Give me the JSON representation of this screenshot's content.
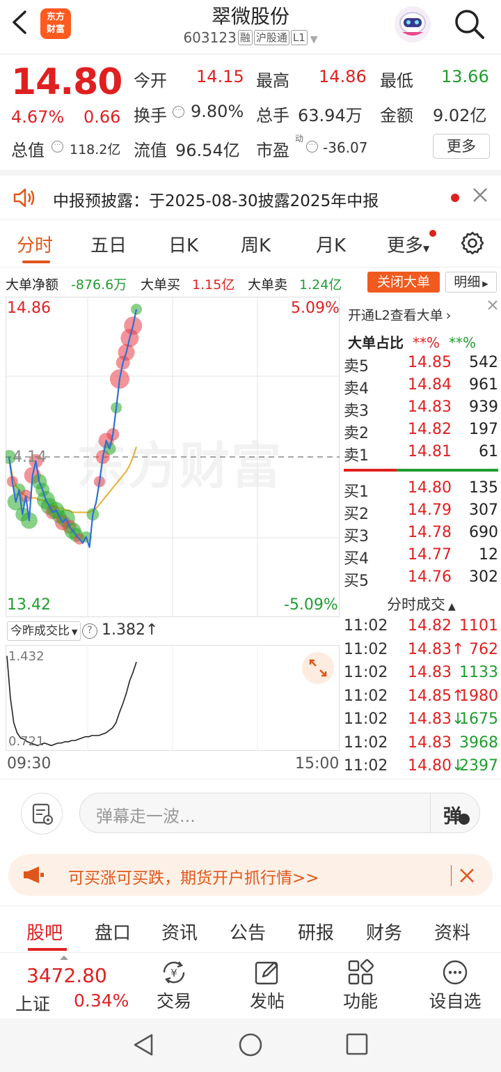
{
  "header": {
    "stock_name": "翠微股份",
    "stock_code": "603123",
    "tags": [
      "融",
      "沪股通",
      "L1"
    ],
    "logo_line1": "东方",
    "logo_line2": "财富"
  },
  "quote": {
    "price": "14.80",
    "change_pct": "4.67%",
    "change": "0.66",
    "open_label": "今开",
    "open": "14.15",
    "high_label": "最高",
    "high": "14.86",
    "low_label": "最低",
    "low": "13.66",
    "turnover_label": "换手",
    "turnover": "9.80%",
    "volume_label": "总手",
    "volume": "63.94万",
    "amount_label": "金额",
    "amount": "9.02亿",
    "mktcap_label": "总值",
    "mktcap": "118.2亿",
    "float_label": "流值",
    "float_cap": "96.54亿",
    "pe_label": "市盈",
    "pe_sup": "动",
    "pe": "-36.07",
    "more": "更多"
  },
  "notice": {
    "text": "中报预披露：于2025-08-30披露2025年中报"
  },
  "tabs": [
    "分时",
    "五日",
    "日K",
    "周K",
    "月K",
    "更多"
  ],
  "big_orders": {
    "net_label": "大单净额",
    "net": "-876.6万",
    "buy_label": "大单买",
    "buy": "1.15亿",
    "sell_label": "大单卖",
    "sell": "1.24亿",
    "close_btn": "关闭大单",
    "detail_btn": "明细"
  },
  "chart_data": {
    "type": "line",
    "title": "",
    "y_top": "14.86",
    "y_mid": "4.14",
    "y_bottom": "13.42",
    "pct_top": "5.09%",
    "pct_bottom": "-5.09%",
    "ylim": [
      13.42,
      14.86
    ],
    "prev_close": 14.14,
    "price_series": [
      14.14,
      14.02,
      13.92,
      13.98,
      13.86,
      13.95,
      13.83,
      14.05,
      14.12,
      14.02,
      13.98,
      13.93,
      13.9,
      13.87,
      13.88,
      13.85,
      13.82,
      13.84,
      13.8,
      13.78,
      13.76,
      13.74,
      13.72,
      13.75,
      13.7,
      13.86,
      13.92,
      14.02,
      14.14,
      14.22,
      14.18,
      14.25,
      14.38,
      14.52,
      14.6,
      14.65,
      14.72,
      14.78,
      14.86
    ],
    "avg_series": [
      14.14,
      14.05,
      14.0,
      13.98,
      13.96,
      13.95,
      13.94,
      13.94,
      13.94,
      13.93,
      13.93,
      13.92,
      13.91,
      13.9,
      13.9,
      13.89,
      13.89,
      13.88,
      13.88,
      13.87,
      13.87,
      13.87,
      13.87,
      13.87,
      13.87,
      13.88,
      13.89,
      13.91,
      13.93,
      13.95,
      13.97,
      13.99,
      14.01,
      14.03,
      14.05,
      14.07,
      14.1,
      14.14,
      14.19
    ],
    "bubbles": [
      {
        "i": 0,
        "c": "g",
        "s": 10
      },
      {
        "i": 1,
        "c": "r",
        "s": 8
      },
      {
        "i": 2,
        "c": "g",
        "s": 12
      },
      {
        "i": 3,
        "c": "g",
        "s": 9
      },
      {
        "i": 4,
        "c": "g",
        "s": 10
      },
      {
        "i": 5,
        "c": "r",
        "s": 9
      },
      {
        "i": 6,
        "c": "g",
        "s": 12
      },
      {
        "i": 7,
        "c": "r",
        "s": 12
      },
      {
        "i": 8,
        "c": "r",
        "s": 10
      },
      {
        "i": 9,
        "c": "g",
        "s": 11
      },
      {
        "i": 10,
        "c": "g",
        "s": 10
      },
      {
        "i": 11,
        "c": "g",
        "s": 13
      },
      {
        "i": 12,
        "c": "g",
        "s": 12
      },
      {
        "i": 13,
        "c": "r",
        "s": 10
      },
      {
        "i": 14,
        "c": "g",
        "s": 12
      },
      {
        "i": 15,
        "c": "g",
        "s": 10
      },
      {
        "i": 16,
        "c": "r",
        "s": 11
      },
      {
        "i": 17,
        "c": "g",
        "s": 13
      },
      {
        "i": 18,
        "c": "r",
        "s": 10
      },
      {
        "i": 19,
        "c": "g",
        "s": 12
      },
      {
        "i": 20,
        "c": "g",
        "s": 10
      },
      {
        "i": 21,
        "c": "r",
        "s": 8
      },
      {
        "i": 23,
        "c": "g",
        "s": 8
      },
      {
        "i": 25,
        "c": "g",
        "s": 9
      },
      {
        "i": 27,
        "c": "r",
        "s": 8
      },
      {
        "i": 28,
        "c": "r",
        "s": 10
      },
      {
        "i": 29,
        "c": "r",
        "s": 11
      },
      {
        "i": 30,
        "c": "g",
        "s": 9
      },
      {
        "i": 31,
        "c": "r",
        "s": 9
      },
      {
        "i": 32,
        "c": "g",
        "s": 8
      },
      {
        "i": 33,
        "c": "r",
        "s": 14
      },
      {
        "i": 34,
        "c": "r",
        "s": 10
      },
      {
        "i": 35,
        "c": "r",
        "s": 12
      },
      {
        "i": 36,
        "c": "r",
        "s": 13
      },
      {
        "i": 37,
        "c": "r",
        "s": 13
      },
      {
        "i": 38,
        "c": "g",
        "s": 8
      }
    ],
    "xlabels": [
      "09:30",
      "15:00"
    ]
  },
  "ratio": {
    "label": "今昨成交比",
    "value": "1.382",
    "arrow": "↑",
    "top": "1.432",
    "bottom": "0.721"
  },
  "ratio_series": [
    1.43,
    1.1,
    0.9,
    0.82,
    0.78,
    0.77,
    0.75,
    0.74,
    0.73,
    0.72,
    0.73,
    0.74,
    0.73,
    0.72,
    0.73,
    0.74,
    0.74,
    0.75,
    0.75,
    0.76,
    0.76,
    0.77,
    0.78,
    0.79,
    0.79,
    0.8,
    0.8,
    0.8,
    0.81,
    0.82,
    0.84,
    0.86,
    0.9,
    0.98,
    1.05,
    1.13,
    1.23,
    1.3,
    1.382
  ],
  "right_panel": {
    "l2_link": "开通L2查看大单",
    "ratio_title": "大单占比",
    "ratio_red": "**%",
    "ratio_green": "**%",
    "sells": [
      {
        "label": "卖5",
        "price": "14.85",
        "vol": "542"
      },
      {
        "label": "卖4",
        "price": "14.84",
        "vol": "961"
      },
      {
        "label": "卖3",
        "price": "14.83",
        "vol": "939"
      },
      {
        "label": "卖2",
        "price": "14.82",
        "vol": "197"
      },
      {
        "label": "卖1",
        "price": "14.81",
        "vol": "61"
      }
    ],
    "buys": [
      {
        "label": "买1",
        "price": "14.80",
        "vol": "135"
      },
      {
        "label": "买2",
        "price": "14.79",
        "vol": "307"
      },
      {
        "label": "买3",
        "price": "14.78",
        "vol": "690"
      },
      {
        "label": "买4",
        "price": "14.77",
        "vol": "12"
      },
      {
        "label": "买5",
        "price": "14.76",
        "vol": "302"
      }
    ],
    "trades_title": "分时成交",
    "trades": [
      {
        "time": "11:02",
        "price": "14.82",
        "arrow": "",
        "vol": "1101",
        "vc": "red"
      },
      {
        "time": "11:02",
        "price": "14.83",
        "arrow": "↑",
        "vol": "762",
        "vc": "red"
      },
      {
        "time": "11:02",
        "price": "14.83",
        "arrow": "",
        "vol": "1133",
        "vc": "green"
      },
      {
        "time": "11:02",
        "price": "14.85",
        "arrow": "↑",
        "vol": "1980",
        "vc": "red"
      },
      {
        "time": "11:02",
        "price": "14.83",
        "arrow": "↓",
        "vol": "1675",
        "vc": "green"
      },
      {
        "time": "11:02",
        "price": "14.83",
        "arrow": "",
        "vol": "3968",
        "vc": "green"
      },
      {
        "time": "11:02",
        "price": "14.80",
        "arrow": "↓",
        "vol": "2397",
        "vc": "green"
      }
    ]
  },
  "comment": {
    "placeholder": "弹幕走一波...",
    "dan_btn": "弹"
  },
  "ad": {
    "text": "可买涨可买跌，期货开户抓行情>>"
  },
  "bottom_tabs": [
    "股吧",
    "盘口",
    "资讯",
    "公告",
    "研报",
    "财务",
    "资料"
  ],
  "footer": {
    "index_value": "3472.80",
    "index_name": "上证",
    "index_pct": "0.34%",
    "buttons": [
      "交易",
      "发帖",
      "功能",
      "设自选"
    ]
  },
  "colors": {
    "accent": "#e0561a",
    "up": "#e02020",
    "down": "#1f9d2f"
  }
}
